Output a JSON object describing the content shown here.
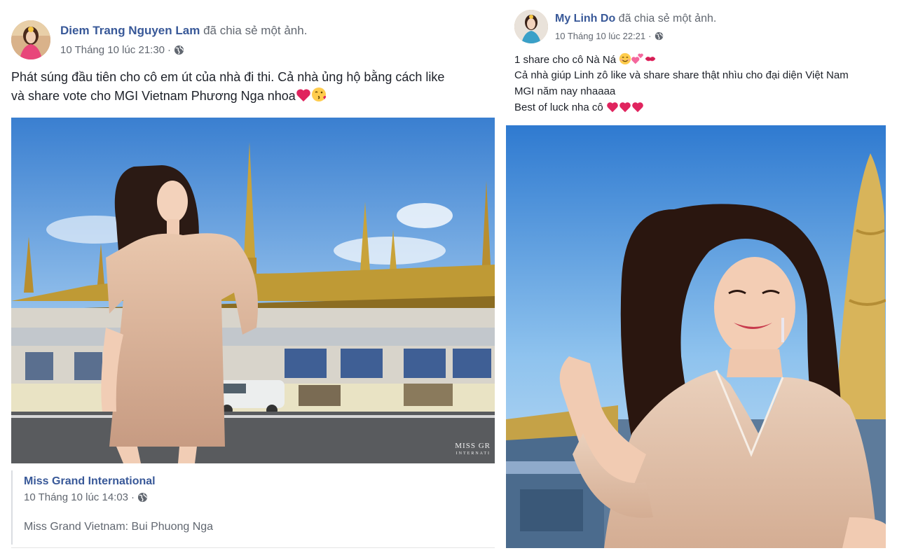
{
  "left_post": {
    "author": "Diem Trang Nguyen Lam",
    "action": "đã chia sẻ một ảnh.",
    "timestamp": "10 Tháng 10 lúc 21:30",
    "separator": "·",
    "text_line1": "Phát súng đầu tiên cho cô em út của nhà đi thi. Cả nhà ủng hộ bằng cách like",
    "text_line2": "và share vote cho MGI Vietnam Phương Nga nhoa",
    "emojis_line2": [
      "red-heart-emoji",
      "kissing-face-emoji"
    ],
    "photo_watermark": "MISS GR",
    "photo_watermark_sub": "INTERNATI",
    "shared": {
      "page_name": "Miss Grand International",
      "timestamp": "10 Tháng 10 lúc 14:03",
      "separator": "·",
      "caption": "Miss Grand Vietnam: Bui Phuong Nga"
    }
  },
  "right_post": {
    "author": "My Linh Do",
    "action": "đã chia sẻ một ảnh.",
    "timestamp": "10 Tháng 10 lúc 22:21",
    "separator": "·",
    "text_line1": "1 share cho cô Nà Ná",
    "emojis_line1": [
      "smiling-face-emoji",
      "two-hearts-emoji",
      "kiss-mark-emoji"
    ],
    "text_line2": "Cả nhà giúp Linh zô like và share share thật nhìu cho đại diện Việt Nam",
    "text_line3": "MGI năm nay nhaaaa",
    "text_line4": "Best of luck nha cô",
    "emojis_line4": [
      "red-heart-emoji",
      "red-heart-emoji",
      "red-heart-emoji"
    ]
  },
  "colors": {
    "link_blue": "#385898",
    "meta_gray": "#616770",
    "text": "#1d2129",
    "heart_red": "#e0245e"
  }
}
